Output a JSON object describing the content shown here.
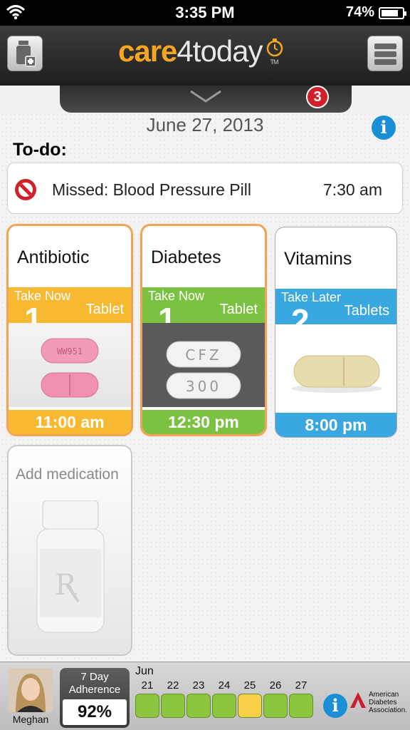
{
  "status_bar": {
    "time": "3:35 PM",
    "battery": "74%",
    "battery_level": 0.74
  },
  "header": {
    "logo_care": "care",
    "logo_4today": "4today",
    "logo_tm": "TM",
    "notification_count": "3"
  },
  "date": "June 27, 2013",
  "todo": {
    "heading": "To-do:",
    "items": [
      {
        "label": "Missed: Blood Pressure Pill",
        "time": "7:30 am"
      }
    ]
  },
  "medications": [
    {
      "name": "Antibiotic",
      "status": "Take Now",
      "dose": "1",
      "unit": "Tablet",
      "time": "11:00 am",
      "color": "#f7b932",
      "pill_text": "WW951"
    },
    {
      "name": "Diabetes",
      "status": "Take Now",
      "dose": "1",
      "unit": "Tablet",
      "time": "12:30 pm",
      "color": "#7cc242",
      "pill_text_1": "CFZ",
      "pill_text_2": "300"
    },
    {
      "name": "Vitamins",
      "status": "Take Later",
      "dose": "2",
      "unit": "Tablets",
      "time": "8:00 pm",
      "color": "#3aa8e0"
    }
  ],
  "add_medication": {
    "label": "Add medication"
  },
  "footer": {
    "user_name": "Meghan",
    "adherence_line1": "7 Day",
    "adherence_line2": "Adherence",
    "adherence_pct": "92%",
    "month": "Jun",
    "days": [
      {
        "day": "21",
        "status_color": "#8cc63f"
      },
      {
        "day": "22",
        "status_color": "#8cc63f"
      },
      {
        "day": "23",
        "status_color": "#8cc63f"
      },
      {
        "day": "24",
        "status_color": "#8cc63f"
      },
      {
        "day": "25",
        "status_color": "#f7d048"
      },
      {
        "day": "26",
        "status_color": "#8cc63f"
      },
      {
        "day": "27",
        "status_color": "#8cc63f"
      }
    ],
    "ada_text": "American Diabetes Association."
  },
  "colors": {
    "accent_orange": "#f6a623",
    "info_blue": "#1b8fd6",
    "missed_red": "#d0202a"
  }
}
